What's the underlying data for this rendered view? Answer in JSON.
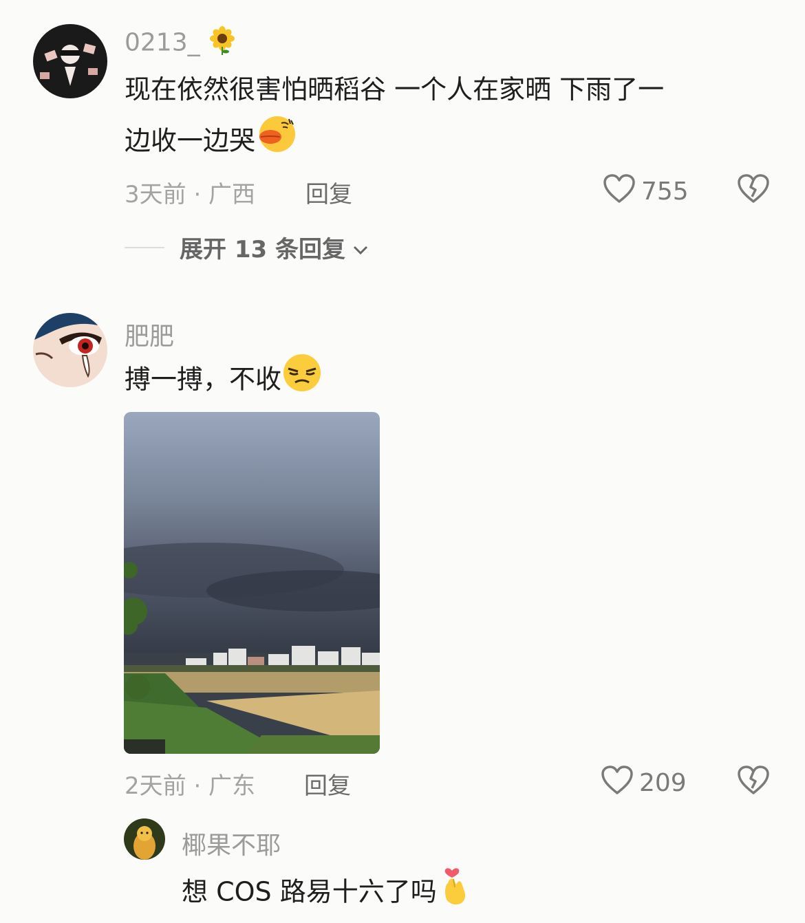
{
  "comments": [
    {
      "username": "0213_",
      "username_emoji": "sunflower",
      "text_line1": "现在依然很害怕晒稻谷 一个人在家晒 下雨了一",
      "text_line2": "边收一边哭",
      "text_emoji": "duck-lips-face",
      "time_location": "3天前 · 广西",
      "reply_label": "回复",
      "likes": "755",
      "expand_label": "展开 13 条回复"
    },
    {
      "username": "肥肥",
      "text": "搏一搏，不收",
      "text_emoji": "unamused-face",
      "time_location": "2天前 · 广东",
      "reply_label": "回复",
      "likes": "209",
      "photo_alt": "storm-clouds-over-rice-field"
    }
  ],
  "reply": {
    "username": "椰果不耶",
    "text": "想 COS 路易十六了吗",
    "text_emoji": "finger-heart"
  },
  "colors": {
    "background": "#fbfbf9",
    "username": "#9b9b9b",
    "meta": "#a3a3a3",
    "text": "#1e1e1e"
  }
}
